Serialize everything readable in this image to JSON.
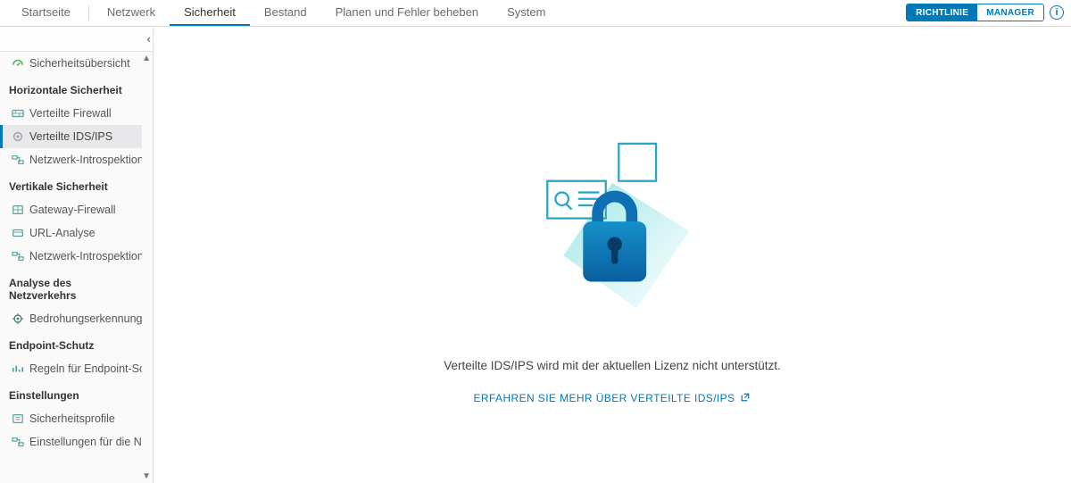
{
  "topnav": {
    "items": [
      "Startseite",
      "Netzwerk",
      "Sicherheit",
      "Bestand",
      "Planen und Fehler beheben",
      "System"
    ],
    "active_index": 2
  },
  "mode_toggle": {
    "left": "RICHTLINIE",
    "right": "MANAGER",
    "active": "left"
  },
  "sidebar": {
    "overview": {
      "label": "Sicherheitsübersicht"
    },
    "groups": [
      {
        "header": "Horizontale Sicherheit",
        "items": [
          {
            "label": "Verteilte Firewall",
            "icon": "firewall",
            "selected": false
          },
          {
            "label": "Verteilte IDS/IPS",
            "icon": "ids",
            "selected": true
          },
          {
            "label": "Netzwerk-Introspektion ...",
            "icon": "introspection",
            "selected": false
          }
        ]
      },
      {
        "header": "Vertikale Sicherheit",
        "items": [
          {
            "label": "Gateway-Firewall",
            "icon": "gateway",
            "selected": false
          },
          {
            "label": "URL-Analyse",
            "icon": "url",
            "selected": false
          },
          {
            "label": "Netzwerk-Introspektion ...",
            "icon": "introspection",
            "selected": false
          }
        ]
      },
      {
        "header": "Analyse des Netzverkehrs",
        "items": [
          {
            "label": "Bedrohungserkennungen",
            "icon": "threat",
            "selected": false
          }
        ]
      },
      {
        "header": "Endpoint-Schutz",
        "items": [
          {
            "label": "Regeln für Endpoint-Sch...",
            "icon": "endpoint",
            "selected": false
          }
        ]
      },
      {
        "header": "Einstellungen",
        "items": [
          {
            "label": "Sicherheitsprofile",
            "icon": "profile",
            "selected": false
          },
          {
            "label": "Einstellungen für die Ne...",
            "icon": "settings",
            "selected": false
          }
        ]
      }
    ]
  },
  "main": {
    "message": "Verteilte IDS/IPS wird mit der aktuellen Lizenz nicht unterstützt.",
    "link_label": "ERFAHREN SIE MEHR ÜBER VERTEILTE IDS/IPS"
  },
  "icons": {
    "gauge_color": "#5ab55a",
    "default_color": "#5aa0a0"
  }
}
